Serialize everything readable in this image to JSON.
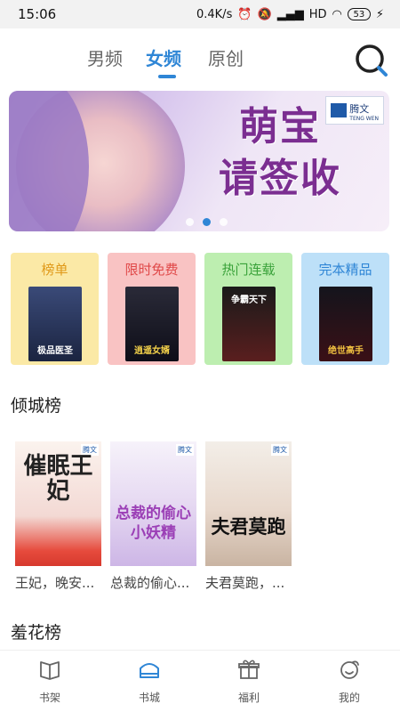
{
  "status_bar": {
    "time": "15:06",
    "net_speed": "0.4K/s",
    "network_label": "HD",
    "battery": "53"
  },
  "top_tabs": [
    {
      "label": "男频",
      "active": false
    },
    {
      "label": "女频",
      "active": true
    },
    {
      "label": "原创",
      "active": false
    }
  ],
  "search_icon": "search-icon",
  "banner": {
    "title_line1": "萌宝",
    "title_line2": "请签收",
    "logo_text": "腾文",
    "logo_sub": "TENG WEN",
    "dots": 3,
    "active_dot": 2
  },
  "categories": [
    {
      "label": "榜单",
      "bg": "#fbe9a6",
      "label_color": "#e09a1a",
      "cover_text": "极品医圣"
    },
    {
      "label": "限时免费",
      "bg": "#f9c3c3",
      "label_color": "#e04848",
      "cover_text": "逍遥女婿"
    },
    {
      "label": "热门连载",
      "bg": "#bdeeb0",
      "label_color": "#3aa23a",
      "cover_text": "争霸天下"
    },
    {
      "label": "完本精品",
      "bg": "#bde0f8",
      "label_color": "#2f86d6",
      "cover_text": "绝世高手"
    }
  ],
  "section_qingcheng": "倾城榜",
  "books": [
    {
      "title": "王妃，晚安...",
      "cover_text": "催眠王妃",
      "cover_tag": "腾文"
    },
    {
      "title": "总裁的偷心...",
      "cover_text": "总裁的偷心小妖精",
      "cover_tag": "腾文"
    },
    {
      "title": "夫君莫跑，...",
      "cover_text": "夫君莫跑",
      "cover_tag": "腾文"
    }
  ],
  "section_xiuhua": "羞花榜",
  "bottom_nav": [
    {
      "label": "书架",
      "icon": "bookshelf-icon",
      "active": false
    },
    {
      "label": "书城",
      "icon": "bookstore-icon",
      "active": true
    },
    {
      "label": "福利",
      "icon": "gift-icon",
      "active": false
    },
    {
      "label": "我的",
      "icon": "profile-icon",
      "active": false
    }
  ],
  "colors": {
    "accent": "#2f86d6"
  }
}
